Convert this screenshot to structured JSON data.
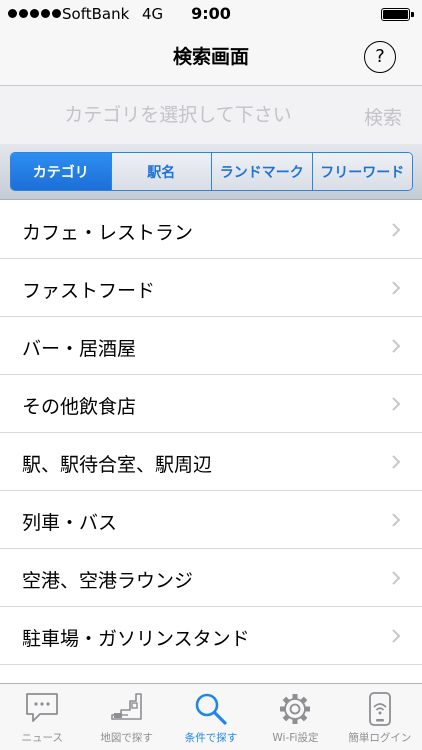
{
  "status_bar": {
    "carrier": "SoftBank",
    "network": "4G",
    "time": "9:00",
    "signal_bars": 5,
    "battery_level": 1.0
  },
  "header": {
    "title": "検索画面",
    "help_label": "?"
  },
  "search": {
    "placeholder": "カテゴリを選択して下さい",
    "value": "",
    "button_label": "検索"
  },
  "segments": [
    {
      "label": "カテゴリ",
      "selected": true
    },
    {
      "label": "駅名",
      "selected": false
    },
    {
      "label": "ランドマーク",
      "selected": false
    },
    {
      "label": "フリーワード",
      "selected": false
    }
  ],
  "categories": [
    {
      "label": "カフェ・レストラン"
    },
    {
      "label": "ファストフード"
    },
    {
      "label": "バー・居酒屋"
    },
    {
      "label": "その他飲食店"
    },
    {
      "label": "駅、駅待合室、駅周辺"
    },
    {
      "label": "列車・バス"
    },
    {
      "label": "空港、空港ラウンジ"
    },
    {
      "label": "駐車場・ガソリンスタンド"
    }
  ],
  "tab_bar": {
    "items": [
      {
        "label": "ニュース",
        "icon": "speech-bubble-icon",
        "active": false
      },
      {
        "label": "地図で探す",
        "icon": "map-icon",
        "active": false
      },
      {
        "label": "条件で探す",
        "icon": "magnifier-icon",
        "active": true
      },
      {
        "label": "Wi-Fi設定",
        "icon": "gear-icon",
        "active": false
      },
      {
        "label": "簡単ログイン",
        "icon": "phone-wifi-icon",
        "active": false
      }
    ]
  },
  "colors": {
    "accent": "#1f86e8",
    "segment_active": "#2e8ef0",
    "inactive": "#8e8e93"
  }
}
